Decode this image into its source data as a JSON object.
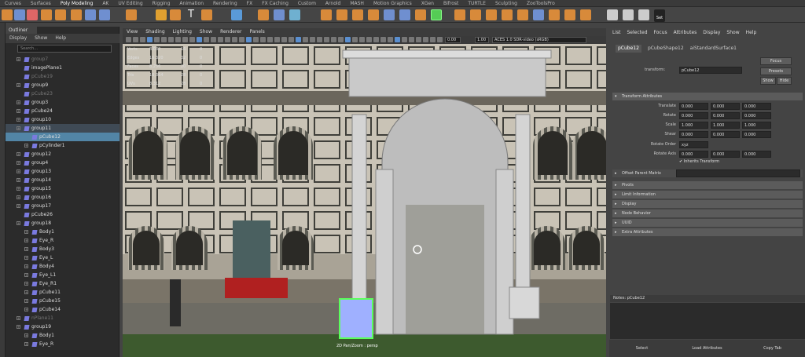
{
  "shelf_tabs": [
    "Curves",
    "Surfaces",
    "Poly Modeling",
    "AK",
    "UV Editing",
    "Rigging",
    "Animation",
    "Rendering",
    "FX",
    "FX Caching",
    "Custom",
    "Arnold",
    "MASH",
    "Motion Graphics",
    "XGen",
    "Bifrost",
    "TURTLE",
    "Sculpting",
    "ZooToolsPro"
  ],
  "active_shelf_tab": "Poly Modeling",
  "shelf": {
    "set_label": "Set"
  },
  "outliner": {
    "tab": "Outliner",
    "menu": [
      "Display",
      "Show",
      "Help"
    ],
    "search_placeholder": "Search...",
    "items": [
      {
        "label": "group7",
        "indent": 0,
        "expand": true,
        "dim": true
      },
      {
        "label": "imagePlane1",
        "indent": 0,
        "expand": false,
        "dim": false
      },
      {
        "label": "pCube19",
        "indent": 0,
        "expand": false,
        "dim": true
      },
      {
        "label": "group9",
        "indent": 0,
        "expand": true,
        "dim": false
      },
      {
        "label": "pCube23",
        "indent": 0,
        "expand": false,
        "dim": true
      },
      {
        "label": "group3",
        "indent": 0,
        "expand": true,
        "dim": false
      },
      {
        "label": "pCube24",
        "indent": 0,
        "expand": true,
        "dim": false
      },
      {
        "label": "group10",
        "indent": 0,
        "expand": true,
        "dim": false
      },
      {
        "label": "group11",
        "indent": 0,
        "expand": true,
        "dim": false,
        "sel2": true
      },
      {
        "label": "pCube12",
        "indent": 1,
        "expand": false,
        "dim": false,
        "sel": true
      },
      {
        "label": "pCylinder1",
        "indent": 1,
        "expand": true,
        "dim": false
      },
      {
        "label": "group12",
        "indent": 0,
        "expand": true,
        "dim": false
      },
      {
        "label": "group4",
        "indent": 0,
        "expand": true,
        "dim": false
      },
      {
        "label": "group13",
        "indent": 0,
        "expand": true,
        "dim": false
      },
      {
        "label": "group14",
        "indent": 0,
        "expand": true,
        "dim": false
      },
      {
        "label": "group15",
        "indent": 0,
        "expand": true,
        "dim": false
      },
      {
        "label": "group16",
        "indent": 0,
        "expand": true,
        "dim": false
      },
      {
        "label": "group17",
        "indent": 0,
        "expand": true,
        "dim": false
      },
      {
        "label": "pCube26",
        "indent": 0,
        "expand": false,
        "dim": false
      },
      {
        "label": "group18",
        "indent": 0,
        "expand": true,
        "dim": false
      },
      {
        "label": "Body1",
        "indent": 1,
        "expand": true,
        "dim": false
      },
      {
        "label": "Eye_R",
        "indent": 1,
        "expand": true,
        "dim": false
      },
      {
        "label": "Body3",
        "indent": 1,
        "expand": true,
        "dim": false
      },
      {
        "label": "Eye_L",
        "indent": 1,
        "expand": true,
        "dim": false
      },
      {
        "label": "Body4",
        "indent": 1,
        "expand": true,
        "dim": false
      },
      {
        "label": "Eye_L1",
        "indent": 1,
        "expand": true,
        "dim": false
      },
      {
        "label": "Eye_R1",
        "indent": 1,
        "expand": true,
        "dim": false
      },
      {
        "label": "pCube11",
        "indent": 1,
        "expand": true,
        "dim": false
      },
      {
        "label": "pCube15",
        "indent": 1,
        "expand": true,
        "dim": false
      },
      {
        "label": "pCube14",
        "indent": 1,
        "expand": true,
        "dim": false
      },
      {
        "label": "nPlane11",
        "indent": 0,
        "expand": true,
        "dim": true
      },
      {
        "label": "group19",
        "indent": 0,
        "expand": true,
        "dim": false
      },
      {
        "label": "Body1",
        "indent": 1,
        "expand": true,
        "dim": false
      },
      {
        "label": "Eye_R",
        "indent": 1,
        "expand": true,
        "dim": false
      }
    ]
  },
  "viewport": {
    "menu": [
      "View",
      "Shading",
      "Lighting",
      "Show",
      "Renderer",
      "Panels"
    ],
    "exposure": "0.00",
    "gamma": "1.00",
    "colorspace": "ACES 1.0 SDR-video (sRGB)",
    "camera_label": "2D Pan/Zoom : persp",
    "hud": [
      {
        "k": "Verts",
        "v": "8,032",
        "b": "16",
        "c": "0"
      },
      {
        "k": "Edges",
        "v": "16,320",
        "b": "32",
        "c": "0"
      },
      {
        "k": "Faces",
        "v": "8,256",
        "b": "20",
        "c": "0"
      },
      {
        "k": "Tris",
        "v": "16,364",
        "b": "28",
        "c": "0"
      },
      {
        "k": "UVs",
        "v": "8,312",
        "b": "28",
        "c": "0"
      }
    ]
  },
  "attribute_editor": {
    "menu": [
      "List",
      "Selected",
      "Focus",
      "Attributes",
      "Display",
      "Show",
      "Help"
    ],
    "tabs": [
      "pCube12",
      "pCubeShape12",
      "aiStandardSurface1"
    ],
    "transform_label": "transform:",
    "transform_value": "pCube12",
    "focus_btn": "Focus",
    "presets_btn": "Presets",
    "show_btn": "Show",
    "hide_btn": "Hide",
    "section_transform": "Transform Attributes",
    "rows": [
      {
        "label": "Translate",
        "v": [
          "0.000",
          "0.000",
          "0.000"
        ]
      },
      {
        "label": "Rotate",
        "v": [
          "0.000",
          "0.000",
          "0.000"
        ]
      },
      {
        "label": "Scale",
        "v": [
          "1.000",
          "1.000",
          "1.000"
        ]
      },
      {
        "label": "Shear",
        "v": [
          "0.000",
          "0.000",
          "0.000"
        ]
      }
    ],
    "rotate_order_label": "Rotate Order",
    "rotate_order": "xyz",
    "rotate_axis_label": "Rotate Axis",
    "rotate_axis": [
      "0.000",
      "0.000",
      "0.000"
    ],
    "inherits": "Inherits Transform",
    "offset_parent": "Offset Parent Matrix",
    "sections": [
      "Pivots",
      "Limit Information",
      "Display",
      "Node Behavior",
      "UUID",
      "Extra Attributes"
    ],
    "notes": "Notes:  pCube12",
    "bottom": [
      "Select",
      "Load Attributes",
      "Copy Tab"
    ]
  }
}
